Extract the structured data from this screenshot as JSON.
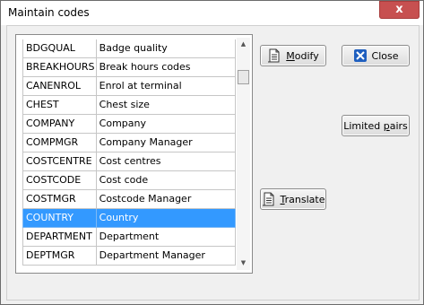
{
  "window": {
    "title": "Maintain codes",
    "close_glyph": "x"
  },
  "codes": [
    {
      "code": "BDGQUAL",
      "description": "Badge quality"
    },
    {
      "code": "BREAKHOURS",
      "description": "Break hours codes"
    },
    {
      "code": "CANENROL",
      "description": "Enrol at terminal"
    },
    {
      "code": "CHEST",
      "description": "Chest size"
    },
    {
      "code": "COMPANY",
      "description": "Company"
    },
    {
      "code": "COMPMGR",
      "description": "Company Manager"
    },
    {
      "code": "COSTCENTRE",
      "description": "Cost centres"
    },
    {
      "code": "COSTCODE",
      "description": "Cost code"
    },
    {
      "code": "COSTMGR",
      "description": "Costcode Manager"
    },
    {
      "code": "COUNTRY",
      "description": "Country",
      "selected": true
    },
    {
      "code": "DEPARTMENT",
      "description": "Department"
    },
    {
      "code": "DEPTMGR",
      "description": "Department Manager"
    }
  ],
  "buttons": {
    "modify": {
      "label_access": "M",
      "label_rest": "odify",
      "icon": "document-icon"
    },
    "translate": {
      "label_access": "T",
      "label_rest": "ranslate",
      "icon": "document-icon"
    },
    "close": {
      "label": "Close",
      "icon": "close-icon"
    },
    "limited_pairs": {
      "label_pre": "Limited ",
      "label_access": "p",
      "label_rest": "airs"
    }
  },
  "colors": {
    "selection": "#3399ff",
    "title_close": "#c75050"
  }
}
